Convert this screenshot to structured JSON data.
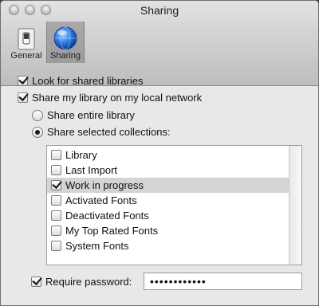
{
  "window": {
    "title": "Sharing"
  },
  "toolbar": {
    "items": [
      {
        "label": "General",
        "icon": "switch-icon",
        "selected": false
      },
      {
        "label": "Sharing",
        "icon": "globe-icon",
        "selected": true
      }
    ]
  },
  "options": {
    "look_shared": {
      "label": "Look for shared libraries",
      "checked": true
    },
    "share_library": {
      "label": "Share my library on my local network",
      "checked": true
    },
    "share_entire": {
      "label": "Share entire library",
      "selected": false
    },
    "share_selected": {
      "label": "Share selected collections:",
      "selected": true
    }
  },
  "collections": [
    {
      "label": "Library",
      "checked": false
    },
    {
      "label": "Last Import",
      "checked": false
    },
    {
      "label": "Work in progress",
      "checked": true
    },
    {
      "label": "Activated Fonts",
      "checked": false
    },
    {
      "label": "Deactivated Fonts",
      "checked": false
    },
    {
      "label": "My Top Rated Fonts",
      "checked": false
    },
    {
      "label": "System Fonts",
      "checked": false
    }
  ],
  "password": {
    "label": "Require password:",
    "checked": true,
    "value": "••••••••••••"
  },
  "colors": {
    "toolbar_selected": "#a3a3a3",
    "highlight_row": "#d4d4d4",
    "globe": "#1f5fd6"
  }
}
